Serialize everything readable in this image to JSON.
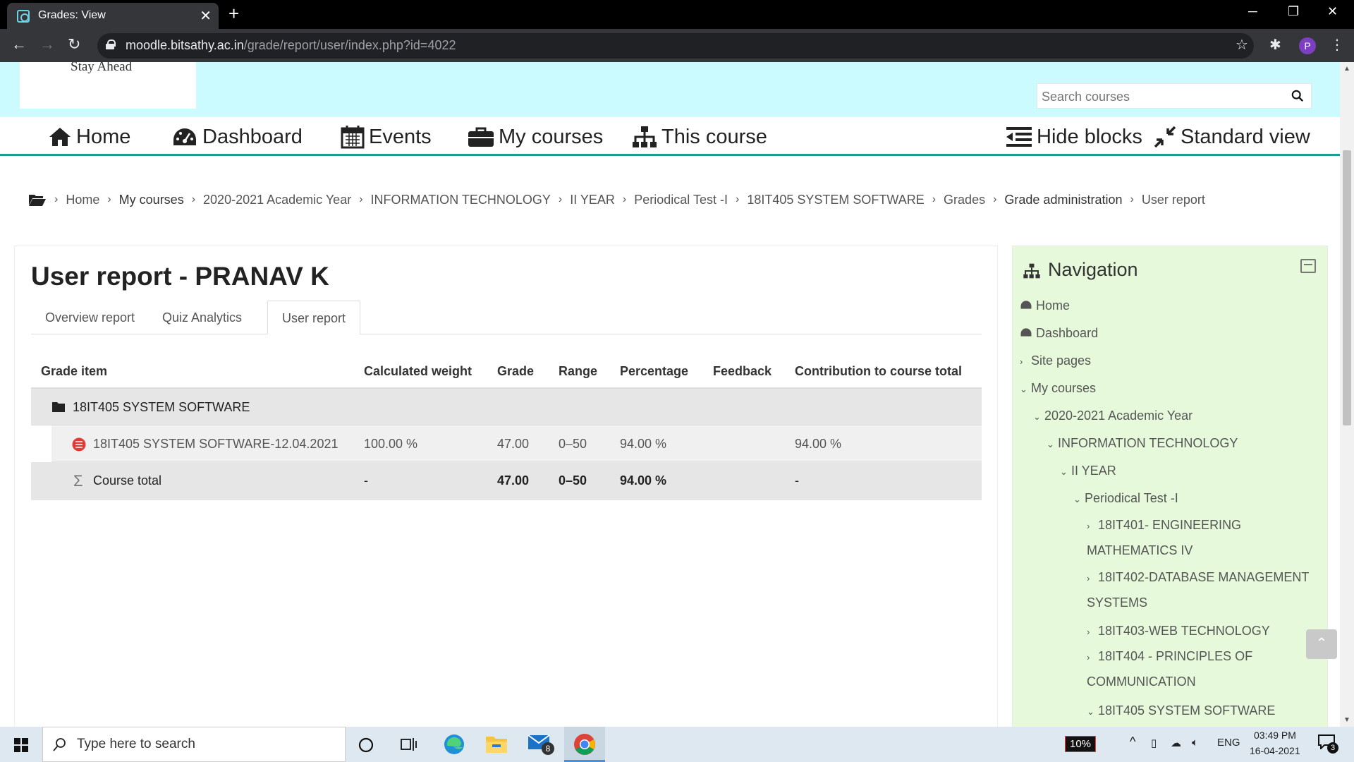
{
  "browser": {
    "tab_title": "Grades: View",
    "url_host": "moodle.bitsathy.ac.in",
    "url_path": "/grade/report/user/index.php?id=4022",
    "profile_initial": "P"
  },
  "header": {
    "logo_tagline": "Stay Ahead",
    "search_placeholder": "Search courses"
  },
  "navbar": {
    "home": "Home",
    "dashboard": "Dashboard",
    "events": "Events",
    "my_courses": "My courses",
    "this_course": "This course",
    "hide_blocks": "Hide blocks",
    "standard_view": "Standard view"
  },
  "breadcrumb": [
    "Home",
    "My courses",
    "2020-2021 Academic Year",
    "INFORMATION TECHNOLOGY",
    "II YEAR",
    "Periodical Test -I",
    "18IT405 SYSTEM SOFTWARE",
    "Grades",
    "Grade administration",
    "User report"
  ],
  "main": {
    "title": "User report - PRANAV K",
    "tabs": [
      "Overview report",
      "Quiz Analytics",
      "User report"
    ],
    "table": {
      "headers": [
        "Grade item",
        "Calculated weight",
        "Grade",
        "Range",
        "Percentage",
        "Feedback",
        "Contribution to course total"
      ],
      "category": "18IT405 SYSTEM SOFTWARE",
      "item": {
        "name": "18IT405 SYSTEM SOFTWARE-12.04.2021",
        "weight": "100.00 %",
        "grade": "47.00",
        "range": "0–50",
        "percentage": "94.00 %",
        "feedback": "",
        "contribution": "94.00 %"
      },
      "total": {
        "name": "Course total",
        "weight": "-",
        "grade": "47.00",
        "range": "0–50",
        "percentage": "94.00 %",
        "feedback": "",
        "contribution": "-"
      }
    }
  },
  "navigation": {
    "title": "Navigation",
    "items": [
      "Home",
      "Dashboard",
      "Site pages",
      "My courses",
      "2020-2021 Academic Year",
      "INFORMATION TECHNOLOGY",
      "II YEAR",
      "Periodical Test -I",
      "18IT401- ENGINEERING MATHEMATICS IV",
      "18IT402-DATABASE MANAGEMENT SYSTEMS",
      "18IT403-WEB TECHNOLOGY",
      "18IT404 - PRINCIPLES OF COMMUNICATION",
      "18IT405 SYSTEM SOFTWARE"
    ]
  },
  "taskbar": {
    "search_placeholder": "Type here to search",
    "mail_badge": "8",
    "battery": "10%",
    "language": "ENG",
    "time": "03:49 PM",
    "date": "16-04-2021",
    "notifications": "3"
  }
}
